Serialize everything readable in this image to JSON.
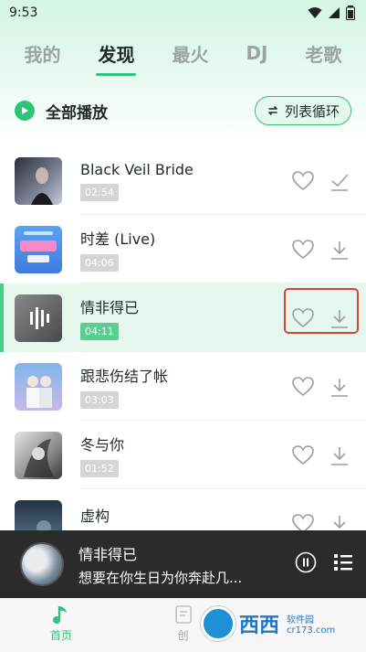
{
  "status_bar": {
    "time": "9:53"
  },
  "tabs": [
    {
      "label": "我的",
      "active": false
    },
    {
      "label": "发现",
      "active": true
    },
    {
      "label": "最火",
      "active": false
    },
    {
      "label": "DJ",
      "active": false
    },
    {
      "label": "老歌",
      "active": false
    }
  ],
  "toolbar": {
    "play_all_label": "全部播放",
    "loop_label": "列表循环"
  },
  "songs": [
    {
      "title": "Black Veil Bride",
      "duration": "02:54",
      "playing": false
    },
    {
      "title": "时差 (Live)",
      "duration": "04:06",
      "playing": false
    },
    {
      "title": "情非得已",
      "duration": "04:11",
      "playing": true
    },
    {
      "title": "跟悲伤结了帐",
      "duration": "03:03",
      "playing": false
    },
    {
      "title": "冬与你",
      "duration": "01:52",
      "playing": false
    },
    {
      "title": "虚构",
      "duration": "",
      "playing": false
    }
  ],
  "now_playing": {
    "title": "情非得已",
    "lyric": "想要在你生日为你奔赴几..."
  },
  "bottom_nav": [
    {
      "label": "首页",
      "active": true
    },
    {
      "label": "创",
      "active": false
    }
  ],
  "watermark": {
    "text": "西西",
    "sub": "软件园",
    "url": "cr173.com"
  },
  "colors": {
    "accent": "#2fc37a",
    "highlight": "#d0483a",
    "player_bg": "#2a2b2b"
  }
}
